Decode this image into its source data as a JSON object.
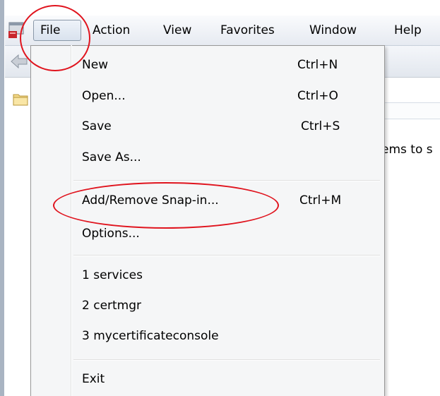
{
  "menubar": {
    "items": [
      {
        "label": "File"
      },
      {
        "label": "Action"
      },
      {
        "label": "View"
      },
      {
        "label": "Favorites"
      },
      {
        "label": "Window"
      },
      {
        "label": "Help"
      }
    ]
  },
  "file_menu": {
    "new": {
      "label": "New",
      "shortcut": "Ctrl+N"
    },
    "open": {
      "label": "Open...",
      "shortcut": "Ctrl+O"
    },
    "save": {
      "label": "Save",
      "shortcut": "Ctrl+S"
    },
    "save_as": {
      "label": "Save As..."
    },
    "add_remove_snapin": {
      "label": "Add/Remove Snap-in...",
      "shortcut": "Ctrl+M"
    },
    "options": {
      "label": "Options..."
    },
    "recent": [
      {
        "label": "1 services"
      },
      {
        "label": "2 certmgr"
      },
      {
        "label": "3 mycertificateconsole"
      }
    ],
    "exit": {
      "label": "Exit"
    }
  },
  "background_text": "ems to s",
  "icons": {
    "app": "mmc-app-icon",
    "back": "back-arrow-icon",
    "folder": "folder-icon"
  },
  "colors": {
    "annotation": "#e0141e",
    "menu_background": "#f5f6f7",
    "active_menu_border": "#8a98a8"
  }
}
